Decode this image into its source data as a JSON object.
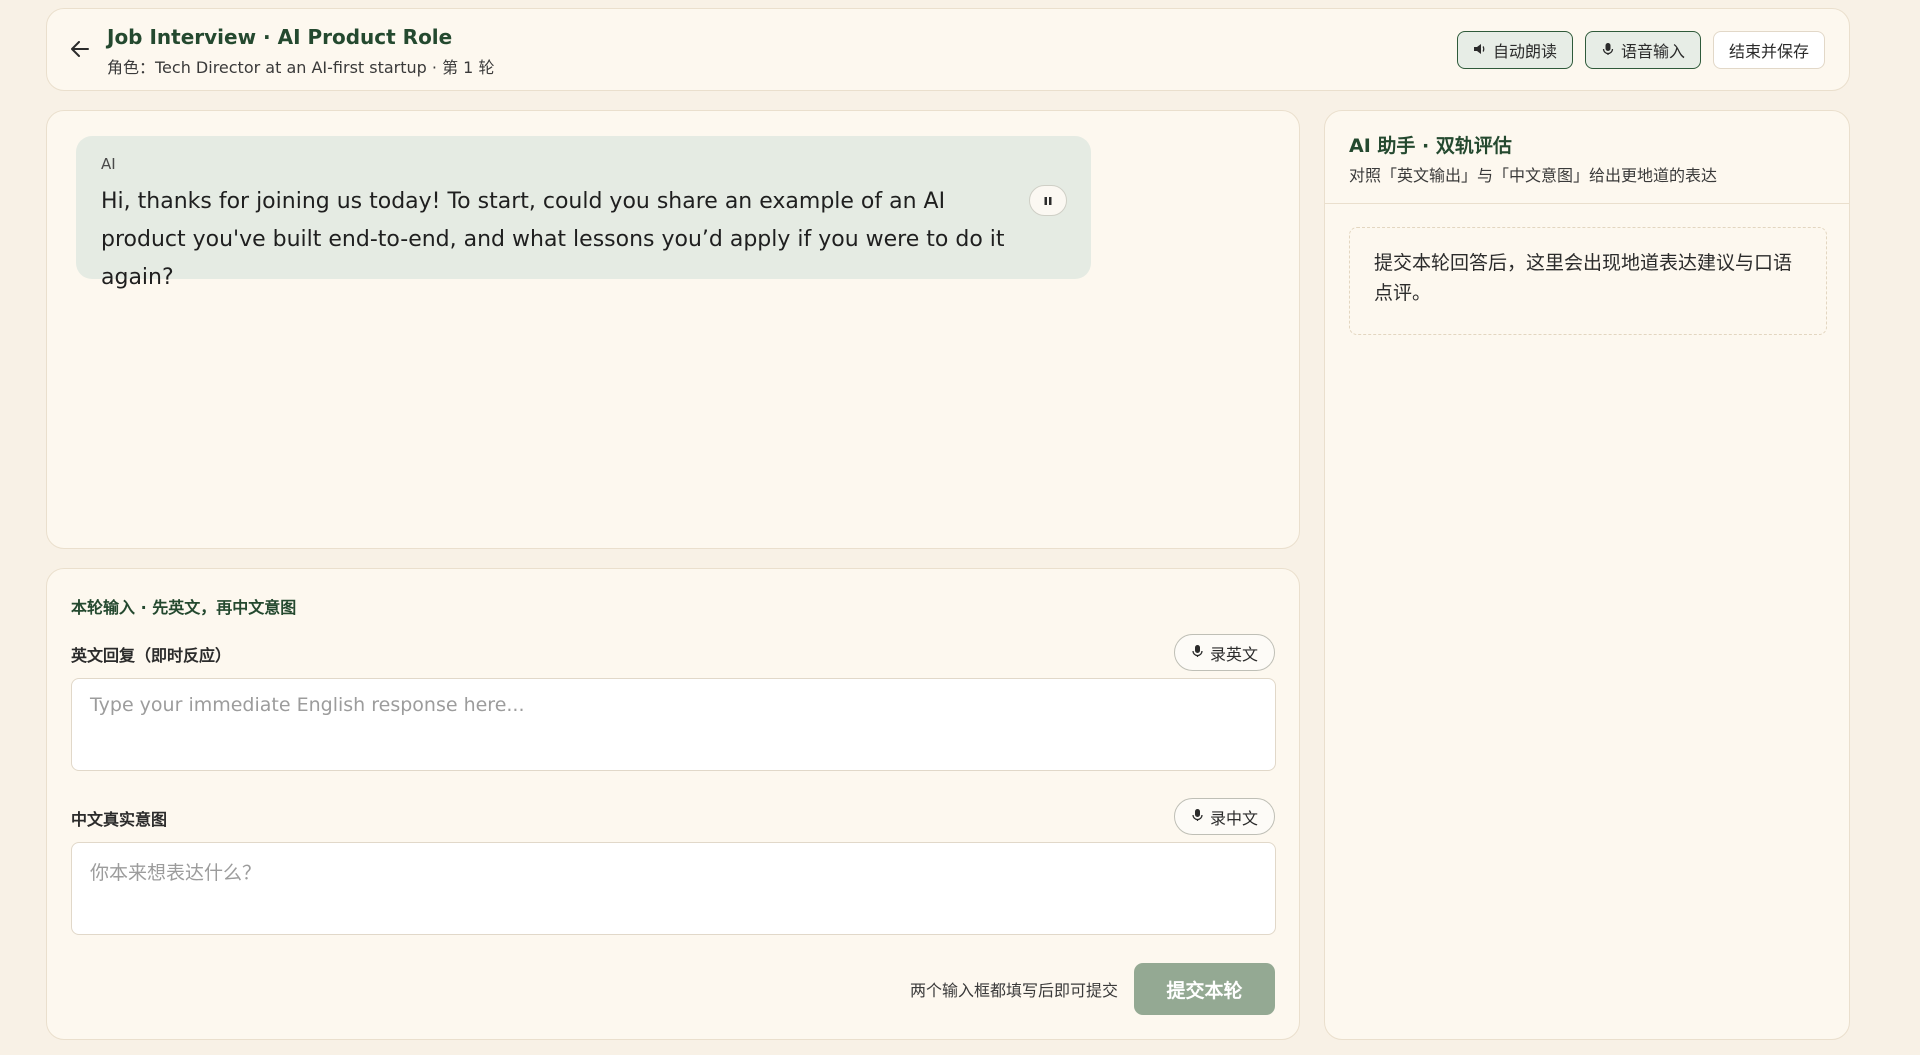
{
  "header": {
    "title": "Job Interview · AI Product Role",
    "subtitle": "角色：Tech Director at an AI-first startup · 第 1 轮",
    "buttons": {
      "auto_read": "自动朗读",
      "voice_input": "语音输入",
      "end_save": "结束并保存"
    }
  },
  "chat": {
    "messages": [
      {
        "sender": "AI",
        "text": "Hi, thanks for joining us today! To start, could you share an example of an AI product you've built end-to-end, and what lessons you’d apply if you were to do it again?"
      }
    ]
  },
  "input_panel": {
    "title": "本轮输入 · 先英文，再中文意图",
    "english": {
      "label": "英文回复（即时反应）",
      "record_label": "录英文",
      "placeholder": "Type your immediate English response here...",
      "value": ""
    },
    "chinese": {
      "label": "中文真实意图",
      "record_label": "录中文",
      "placeholder": "你本来想表达什么？",
      "value": ""
    },
    "hint": "两个输入框都填写后即可提交",
    "submit_label": "提交本轮"
  },
  "assistant": {
    "title": "AI 助手 · 双轨评估",
    "subtitle": "对照「英文输出」与「中文意图」给出更地道的表达",
    "placeholder": "提交本轮回答后，这里会出现地道表达建议与口语点评。"
  },
  "colors": {
    "background": "#f8f1e6",
    "card": "#fdf8ef",
    "accent_green": "#24492f",
    "ai_bubble": "#e5ebe3",
    "submit_disabled": "#94a993"
  }
}
